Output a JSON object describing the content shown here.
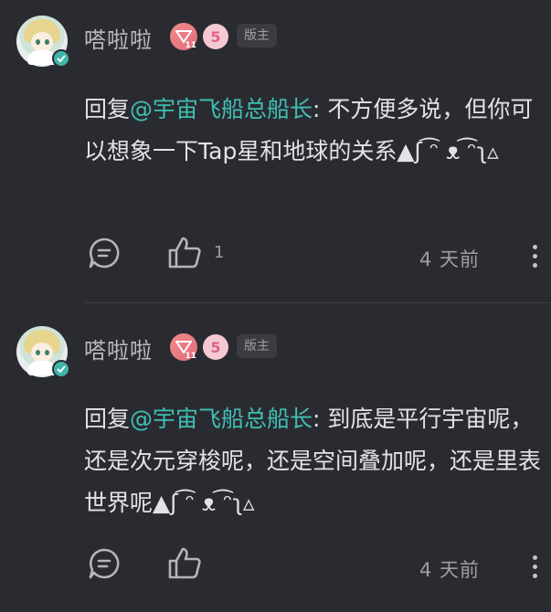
{
  "comments": [
    {
      "username": "嗒啦啦",
      "level_badge_num": "11",
      "pink_badge_glyph": "5",
      "role_tag": "版主",
      "reply_prefix": "回复",
      "mention": "@宇宙飞船总船长",
      "text": ": 不方便多说，但你可以想象一下Tap星和地球的关系▲ʃ ͡ᵔ ᴥ ͡ᵔʅ▵",
      "like_count": "1",
      "time": "4 天前",
      "icons": {
        "reply": "comment-bubble-icon",
        "like": "thumbs-up-icon",
        "more": "more-vertical-icon",
        "verified": "verified-check-icon"
      }
    },
    {
      "username": "嗒啦啦",
      "level_badge_num": "11",
      "pink_badge_glyph": "5",
      "role_tag": "版主",
      "reply_prefix": "回复",
      "mention": "@宇宙飞船总船长",
      "text": ": 到底是平行宇宙呢，还是次元穿梭呢，还是空间叠加呢，还是里表世界呢▲ʃ ͡ᵔ ᴥ ͡ᵔʅ▵",
      "like_count": "",
      "time": "4 天前",
      "icons": {
        "reply": "comment-bubble-icon",
        "like": "thumbs-up-icon",
        "more": "more-vertical-icon",
        "verified": "verified-check-icon"
      }
    }
  ],
  "colors": {
    "background": "#2a2b30",
    "mention": "#3fbfb4",
    "verified": "#3fb5a8",
    "level_badge": "#e06d7d"
  }
}
